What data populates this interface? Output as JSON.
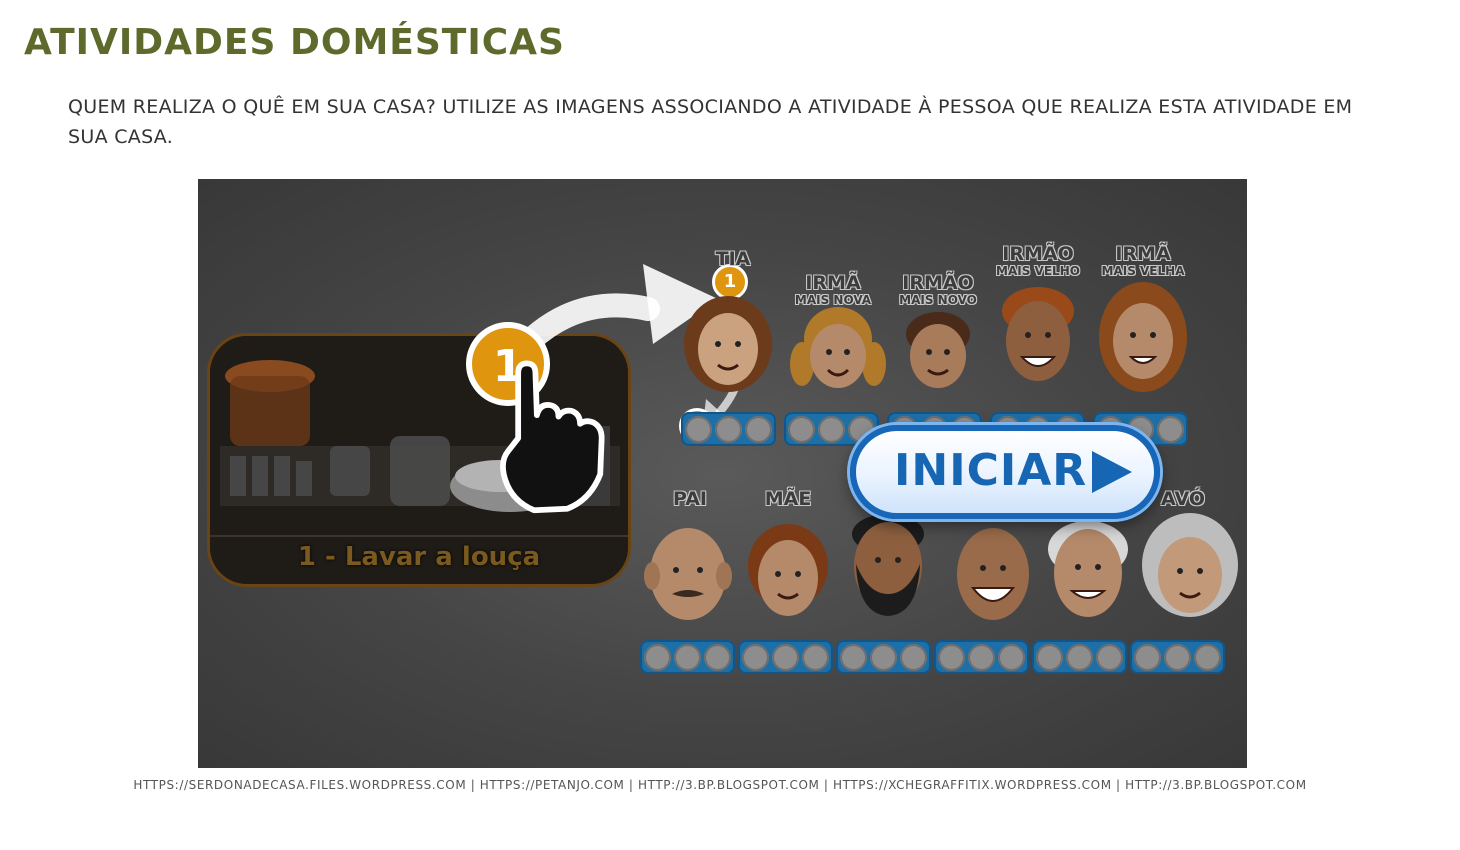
{
  "page": {
    "title": "ATIVIDADES DOMÉSTICAS",
    "instructions": "QUEM REALIZA O QUÊ EM SUA CASA? UTILIZE AS IMAGENS ASSOCIANDO A ATIVIDADE À PESSOA QUE REALIZA ESTA ATIVIDADE EM SUA CASA.",
    "sources": "HTTPS://SERDONADECASA.FILES.WORDPRESS.COM | HTTPS://PETANJO.COM | HTTP://3.BP.BLOGSPOT.COM | HTTPS://XCHEGRAFFITIX.WORDPRESS.COM | HTTP://3.BP.BLOGSPOT.COM"
  },
  "game": {
    "activity_card": {
      "label": "1 - Lavar a louça"
    },
    "hint_badge": "1",
    "start_button": {
      "label": "INICIAR",
      "icon": "play-arrow-icon"
    },
    "colors": {
      "badge": "#e0950f",
      "slot_bar": "#1d6fa8",
      "button_text": "#1766b3",
      "title": "#5e6a2c"
    },
    "top_row": [
      {
        "name": "TIA",
        "sub": ""
      },
      {
        "name": "IRMÃ",
        "sub": "MAIS NOVA"
      },
      {
        "name": "IRMÃO",
        "sub": "MAIS NOVO"
      },
      {
        "name": "IRMÃO",
        "sub": "MAIS VELHO"
      },
      {
        "name": "IRMÃ",
        "sub": "MAIS VELHA"
      }
    ],
    "bottom_row": [
      {
        "name": "PAI",
        "sub": ""
      },
      {
        "name": "MÃE",
        "sub": ""
      },
      {
        "name": "",
        "sub": ""
      },
      {
        "name": "",
        "sub": ""
      },
      {
        "name": "",
        "sub": ""
      },
      {
        "name": "AVÓ",
        "sub": ""
      }
    ]
  }
}
